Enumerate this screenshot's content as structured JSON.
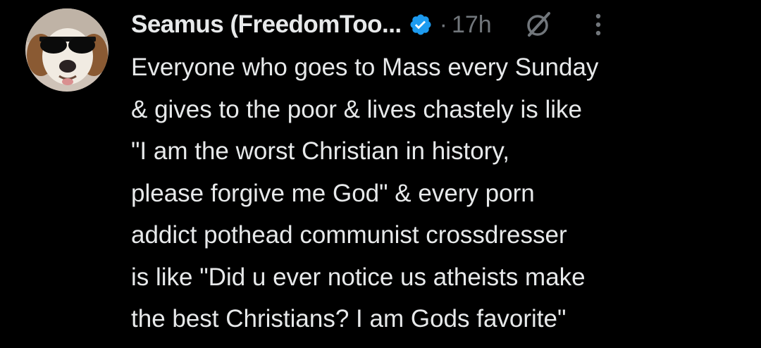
{
  "author": {
    "display_name": "Seamus (FreedomToo...",
    "verified_icon": "verified-badge-icon",
    "avatar_icon": "dog-with-sunglasses-avatar"
  },
  "meta": {
    "separator": "·",
    "timestamp": "17h",
    "grok_icon": "grok-slash-icon",
    "more_icon": "more-options-vertical-icon"
  },
  "text": {
    "lines": [
      "Everyone who goes to Mass every Sunday",
      "& gives to the poor & lives chastely is like",
      "\"I am the worst Christian in history,",
      "please forgive me God\" & every porn",
      "addict pothead communist crossdresser",
      "is like \"Did u ever notice us atheists make",
      "the best Christians? I am Gods favorite\""
    ]
  },
  "colors": {
    "background": "#000000",
    "text_primary": "#e7e9ea",
    "text_secondary": "#71767b",
    "verified_blue": "#1d9bf0"
  }
}
